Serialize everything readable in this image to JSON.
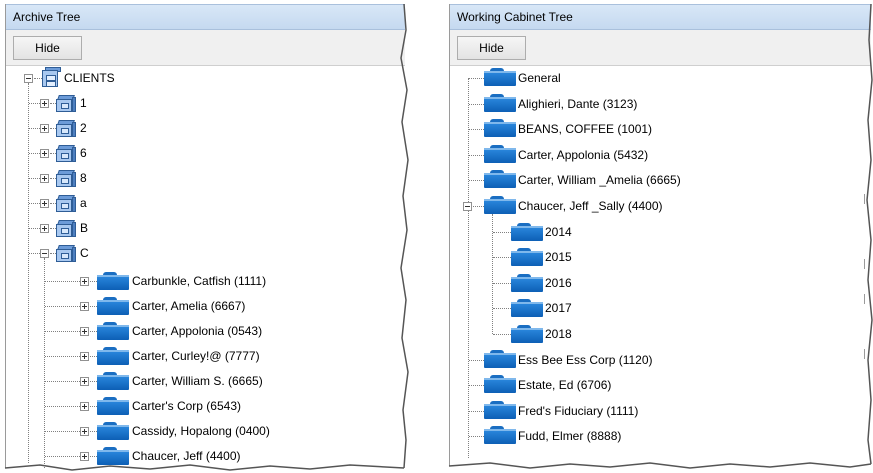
{
  "archive": {
    "title": "Archive Tree",
    "hide_label": "Hide",
    "root": {
      "label": "CLIENTS",
      "icon": "clients-database-icon"
    },
    "cabinets": [
      {
        "label": "1",
        "icon": "file-cabinet-icon",
        "expanded": false
      },
      {
        "label": "2",
        "icon": "file-cabinet-icon",
        "expanded": false
      },
      {
        "label": "6",
        "icon": "file-cabinet-icon",
        "expanded": false
      },
      {
        "label": "8",
        "icon": "file-cabinet-icon",
        "expanded": false
      },
      {
        "label": "a",
        "icon": "file-cabinet-icon",
        "expanded": false
      },
      {
        "label": "B",
        "icon": "file-cabinet-icon",
        "expanded": false
      },
      {
        "label": "C",
        "icon": "file-cabinet-icon",
        "expanded": true
      }
    ],
    "c_children": [
      {
        "label": "Carbunkle, Catfish (1111)",
        "icon": "folder-icon"
      },
      {
        "label": "Carter, Amelia (6667)",
        "icon": "folder-icon"
      },
      {
        "label": "Carter, Appolonia (0543)",
        "icon": "folder-icon"
      },
      {
        "label": "Carter, Curley!@ (7777)",
        "icon": "folder-icon"
      },
      {
        "label": "Carter, William S. (6665)",
        "icon": "folder-icon"
      },
      {
        "label": "Carter's Corp (6543)",
        "icon": "folder-icon"
      },
      {
        "label": "Cassidy, Hopalong (0400)",
        "icon": "folder-icon"
      },
      {
        "label": "Chaucer, Jeff (4400)",
        "icon": "folder-icon"
      }
    ]
  },
  "working": {
    "title": "Working Cabinet Tree",
    "hide_label": "Hide",
    "items": [
      {
        "label": "General",
        "icon": "folder-icon",
        "expanded": null
      },
      {
        "label": "Alighieri, Dante (3123)",
        "icon": "folder-icon",
        "expanded": null
      },
      {
        "label": "BEANS, COFFEE (1001)",
        "icon": "folder-icon",
        "expanded": null
      },
      {
        "label": "Carter, Appolonia (5432)",
        "icon": "folder-icon",
        "expanded": null
      },
      {
        "label": "Carter, William _Amelia (6665)",
        "icon": "folder-icon",
        "expanded": null
      },
      {
        "label": "Chaucer, Jeff _Sally (4400)",
        "icon": "folder-icon",
        "expanded": true
      },
      {
        "label": "Ess Bee Ess Corp (1120)",
        "icon": "folder-icon",
        "expanded": null
      },
      {
        "label": "Estate, Ed (6706)",
        "icon": "folder-icon",
        "expanded": null
      },
      {
        "label": "Fred's Fiduciary (1111)",
        "icon": "folder-icon",
        "expanded": null
      },
      {
        "label": "Fudd, Elmer (8888)",
        "icon": "folder-icon",
        "expanded": null
      }
    ],
    "chaucer_children": [
      {
        "label": "2014",
        "icon": "folder-icon"
      },
      {
        "label": "2015",
        "icon": "folder-icon"
      },
      {
        "label": "2016",
        "icon": "folder-icon"
      },
      {
        "label": "2017",
        "icon": "folder-icon"
      },
      {
        "label": "2018",
        "icon": "folder-icon"
      }
    ]
  },
  "colors": {
    "titlebar": "#c5d9f0",
    "folder": "#1a6ec2",
    "tree_line": "#808080"
  }
}
